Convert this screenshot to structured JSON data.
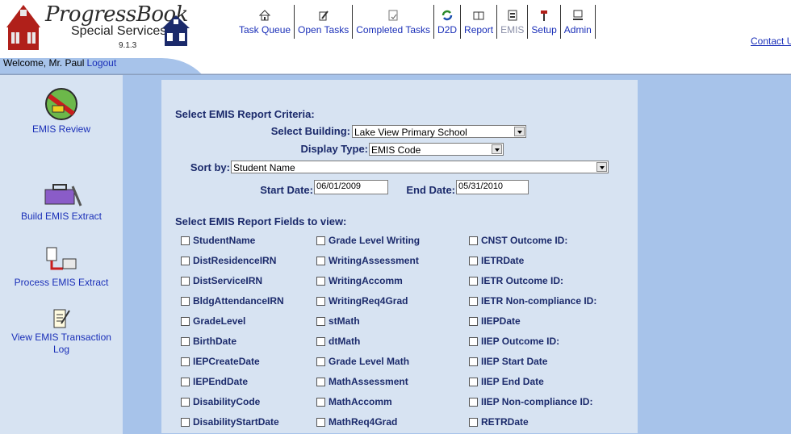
{
  "header": {
    "brand": "ProgressBook",
    "subbrand": "Special Services",
    "version": "9.1.3",
    "welcome": "Welcome, Mr. Paul",
    "logout": "Logout",
    "contact": "Contact Us"
  },
  "nav": [
    {
      "label": "Task Queue",
      "icon": "home-icon"
    },
    {
      "label": "Open Tasks",
      "icon": "edit-icon"
    },
    {
      "label": "Completed Tasks",
      "icon": "document-icon"
    },
    {
      "label": "D2D",
      "icon": "refresh-icon"
    },
    {
      "label": "Report",
      "icon": "book-icon"
    },
    {
      "label": "EMIS",
      "icon": "emis-icon",
      "disabled": true
    },
    {
      "label": "Setup",
      "icon": "hammer-icon"
    },
    {
      "label": "Admin",
      "icon": "computer-icon"
    }
  ],
  "sidebar": {
    "items": [
      {
        "label": "EMIS Review"
      },
      {
        "label": "Build EMIS Extract"
      },
      {
        "label": "Process EMIS Extract"
      },
      {
        "label": "View EMIS Transaction Log"
      }
    ]
  },
  "criteria": {
    "title": "Select EMIS Report Criteria:",
    "building_label": "Select Building:",
    "building_value": "Lake View Primary School",
    "display_label": "Display Type:",
    "display_value": "EMIS Code",
    "sort_label": "Sort by:",
    "sort_value": "Student Name",
    "start_label": "Start Date:",
    "start_value": "06/01/2009",
    "end_label": "End Date:",
    "end_value": "05/31/2010"
  },
  "fields": {
    "title": "Select EMIS Report Fields to view:",
    "col1": [
      "StudentName",
      "DistResidenceIRN",
      "DistServiceIRN",
      "BldgAttendanceIRN",
      "GradeLevel",
      "BirthDate",
      "IEPCreateDate",
      "IEPEndDate",
      "DisabilityCode",
      "DisabilityStartDate"
    ],
    "col2": [
      "Grade Level Writing",
      "WritingAssessment",
      "WritingAccomm",
      "WritingReq4Grad",
      "stMath",
      "dtMath",
      "Grade Level Math",
      "MathAssessment",
      "MathAccomm",
      "MathReq4Grad"
    ],
    "col3": [
      "CNST Outcome ID:",
      "IETRDate",
      "IETR Outcome ID:",
      "IETR Non-compliance ID:",
      "IIEPDate",
      "IIEP Outcome ID:",
      "IIEP Start Date",
      "IIEP End Date",
      "IIEP Non-compliance ID:",
      "RETRDate"
    ]
  },
  "colors": {
    "sidebar_bg": "#d7e3f2",
    "main_bg": "#a7c3ea",
    "panel_bg": "#d7e3f2",
    "label": "#1b2a6b",
    "link": "#1a2fb8"
  }
}
